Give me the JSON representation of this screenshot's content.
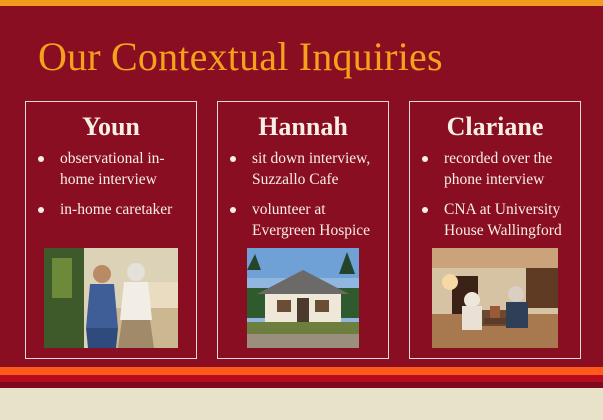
{
  "slide": {
    "title": "Our Contextual Inquiries",
    "colors": {
      "background": "#8a0e22",
      "title": "#f4a11b",
      "text": "#f7efe6",
      "accent_band": "#ff5a1a"
    }
  },
  "cards": [
    {
      "name": "Youn",
      "bullets": [
        "observational in-home interview",
        "in-home caretaker"
      ],
      "photo": "caregiver-with-elderly-woman-photo"
    },
    {
      "name": "Hannah",
      "bullets": [
        "sit down interview, Suzzallo Cafe",
        "volunteer at Evergreen Hospice"
      ],
      "photo": "hospice-building-photo"
    },
    {
      "name": "Clariane",
      "bullets": [
        "recorded over the phone interview",
        "CNA at University House Wallingford"
      ],
      "photo": "retirement-home-lounge-photo"
    }
  ]
}
